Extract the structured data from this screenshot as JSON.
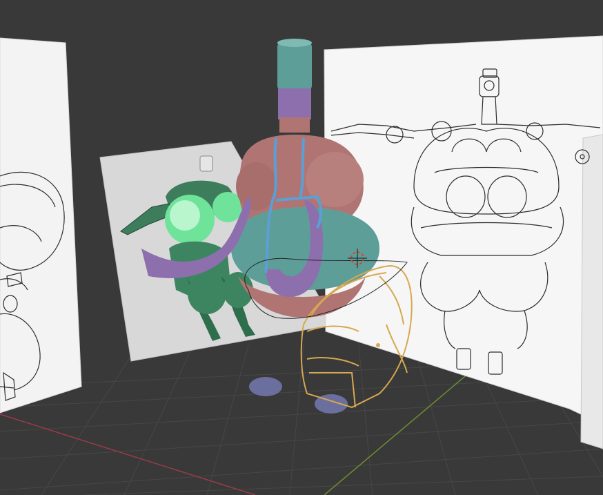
{
  "app": {
    "view": "3d-viewport"
  },
  "colors": {
    "background": "#393939",
    "grid_line": "#4a4a4a",
    "x_axis": "#9a3b47",
    "y_axis": "#6c8f2f",
    "reference_plane": "#f2f2f2",
    "sketch_line": "#2b2b2b",
    "model_mauve": "#b07573",
    "model_teal": "#5e9e99",
    "model_purple": "#8e6fae",
    "model_blue_lines": "#5b9fd6",
    "model_lavender_feet": "#6a6f9e",
    "grease_pencil_gold": "#d7a84f",
    "cursor_red": "#d8423b"
  },
  "scene": {
    "objects": [
      {
        "name": "reference-front-left",
        "type": "image-empty"
      },
      {
        "name": "reference-color-concept",
        "type": "image-empty"
      },
      {
        "name": "reference-front-right",
        "type": "image-empty"
      },
      {
        "name": "character-body-mesh",
        "type": "mesh"
      },
      {
        "name": "grease-pencil-stroke",
        "type": "grease-pencil"
      },
      {
        "name": "3d-cursor",
        "type": "cursor"
      }
    ]
  }
}
